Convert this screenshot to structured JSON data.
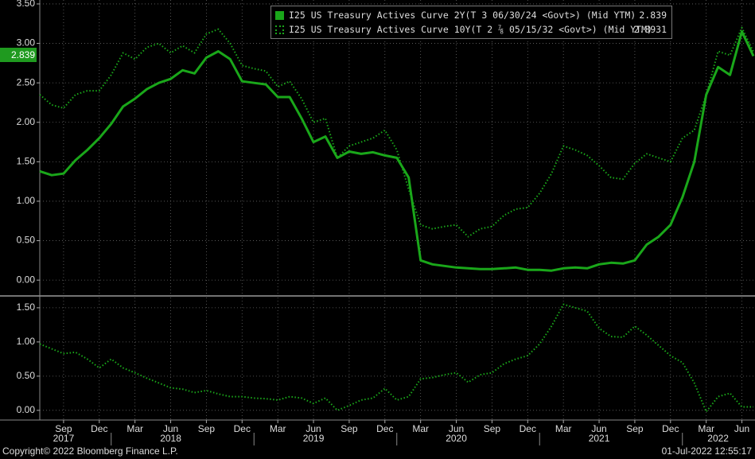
{
  "chart_data": [
    {
      "type": "line",
      "ylim": [
        -0.18,
        3.55
      ],
      "yticks": [
        "3.50",
        "3.00",
        "2.50",
        "2.00",
        "1.50",
        "1.00",
        "0.50",
        "0.00"
      ],
      "grid": true,
      "legend_position": "top-right",
      "last_value_label": "2.839",
      "series": [
        {
          "name": "I25 US Treasury Actives Curve 2Y(T 3 06/30/24 <Govt>) (Mid YTM)",
          "last": "2.839",
          "style": "solid",
          "color": "#1aa71a",
          "x": [
            "2017-07",
            "2017-08",
            "2017-09",
            "2017-10",
            "2017-11",
            "2017-12",
            "2018-01",
            "2018-02",
            "2018-03",
            "2018-04",
            "2018-05",
            "2018-06",
            "2018-07",
            "2018-08",
            "2018-09",
            "2018-10",
            "2018-11",
            "2018-12",
            "2019-01",
            "2019-02",
            "2019-03",
            "2019-04",
            "2019-05",
            "2019-06",
            "2019-07",
            "2019-08",
            "2019-09",
            "2019-10",
            "2019-11",
            "2019-12",
            "2020-01",
            "2020-02",
            "2020-03",
            "2020-04",
            "2020-05",
            "2020-06",
            "2020-07",
            "2020-08",
            "2020-09",
            "2020-10",
            "2020-11",
            "2020-12",
            "2021-01",
            "2021-02",
            "2021-03",
            "2021-04",
            "2021-05",
            "2021-06",
            "2021-07",
            "2021-08",
            "2021-09",
            "2021-10",
            "2021-11",
            "2021-12",
            "2022-01",
            "2022-02",
            "2022-03",
            "2022-04",
            "2022-05",
            "2022-06",
            "2022-06-30"
          ],
          "values": [
            1.38,
            1.33,
            1.35,
            1.52,
            1.65,
            1.8,
            1.98,
            2.2,
            2.3,
            2.42,
            2.5,
            2.55,
            2.66,
            2.62,
            2.82,
            2.9,
            2.8,
            2.52,
            2.5,
            2.48,
            2.32,
            2.32,
            2.05,
            1.75,
            1.82,
            1.55,
            1.63,
            1.6,
            1.62,
            1.58,
            1.55,
            1.3,
            0.25,
            0.2,
            0.18,
            0.16,
            0.15,
            0.14,
            0.14,
            0.15,
            0.16,
            0.13,
            0.13,
            0.12,
            0.15,
            0.16,
            0.15,
            0.2,
            0.22,
            0.21,
            0.25,
            0.45,
            0.55,
            0.7,
            1.05,
            1.5,
            2.35,
            2.7,
            2.6,
            3.15,
            2.839
          ]
        },
        {
          "name": "I25 US Treasury Actives Curve 10Y(T 2 ⅞ 05/15/32 <Govt>) (Mid YTM)",
          "last": "2.8931",
          "style": "dotted",
          "color": "#1aa71a",
          "x": [
            "2017-07",
            "2017-08",
            "2017-09",
            "2017-10",
            "2017-11",
            "2017-12",
            "2018-01",
            "2018-02",
            "2018-03",
            "2018-04",
            "2018-05",
            "2018-06",
            "2018-07",
            "2018-08",
            "2018-09",
            "2018-10",
            "2018-11",
            "2018-12",
            "2019-01",
            "2019-02",
            "2019-03",
            "2019-04",
            "2019-05",
            "2019-06",
            "2019-07",
            "2019-08",
            "2019-09",
            "2019-10",
            "2019-11",
            "2019-12",
            "2020-01",
            "2020-02",
            "2020-03",
            "2020-04",
            "2020-05",
            "2020-06",
            "2020-07",
            "2020-08",
            "2020-09",
            "2020-10",
            "2020-11",
            "2020-12",
            "2021-01",
            "2021-02",
            "2021-03",
            "2021-04",
            "2021-05",
            "2021-06",
            "2021-07",
            "2021-08",
            "2021-09",
            "2021-10",
            "2021-11",
            "2021-12",
            "2022-01",
            "2022-02",
            "2022-03",
            "2022-04",
            "2022-05",
            "2022-06",
            "2022-06-30"
          ],
          "values": [
            2.35,
            2.22,
            2.18,
            2.35,
            2.4,
            2.4,
            2.6,
            2.88,
            2.8,
            2.95,
            3.0,
            2.88,
            2.97,
            2.88,
            3.12,
            3.18,
            3.0,
            2.72,
            2.68,
            2.65,
            2.45,
            2.52,
            2.3,
            2.0,
            2.05,
            1.55,
            1.7,
            1.75,
            1.8,
            1.9,
            1.65,
            1.15,
            0.7,
            0.65,
            0.68,
            0.7,
            0.55,
            0.65,
            0.68,
            0.82,
            0.9,
            0.92,
            1.1,
            1.35,
            1.7,
            1.65,
            1.58,
            1.45,
            1.3,
            1.28,
            1.48,
            1.6,
            1.55,
            1.5,
            1.8,
            1.9,
            2.35,
            2.9,
            2.85,
            3.2,
            2.8931
          ]
        }
      ]
    },
    {
      "type": "line",
      "ylim": [
        -0.13,
        1.65
      ],
      "yticks": [
        "1.50",
        "1.00",
        "0.50",
        "0.00"
      ],
      "grid": true,
      "series": [
        {
          "style": "dotted",
          "color": "#1aa71a",
          "x": [
            "2017-07",
            "2017-08",
            "2017-09",
            "2017-10",
            "2017-11",
            "2017-12",
            "2018-01",
            "2018-02",
            "2018-03",
            "2018-04",
            "2018-05",
            "2018-06",
            "2018-07",
            "2018-08",
            "2018-09",
            "2018-10",
            "2018-11",
            "2018-12",
            "2019-01",
            "2019-02",
            "2019-03",
            "2019-04",
            "2019-05",
            "2019-06",
            "2019-07",
            "2019-08",
            "2019-09",
            "2019-10",
            "2019-11",
            "2019-12",
            "2020-01",
            "2020-02",
            "2020-03",
            "2020-04",
            "2020-05",
            "2020-06",
            "2020-07",
            "2020-08",
            "2020-09",
            "2020-10",
            "2020-11",
            "2020-12",
            "2021-01",
            "2021-02",
            "2021-03",
            "2021-04",
            "2021-05",
            "2021-06",
            "2021-07",
            "2021-08",
            "2021-09",
            "2021-10",
            "2021-11",
            "2021-12",
            "2022-01",
            "2022-02",
            "2022-03",
            "2022-04",
            "2022-05",
            "2022-06",
            "2022-06-30"
          ],
          "values": [
            0.97,
            0.9,
            0.83,
            0.85,
            0.75,
            0.62,
            0.75,
            0.62,
            0.55,
            0.47,
            0.4,
            0.33,
            0.31,
            0.26,
            0.29,
            0.24,
            0.2,
            0.2,
            0.18,
            0.17,
            0.15,
            0.2,
            0.18,
            0.1,
            0.18,
            0.0,
            0.07,
            0.15,
            0.18,
            0.32,
            0.15,
            0.2,
            0.46,
            0.48,
            0.52,
            0.55,
            0.41,
            0.52,
            0.55,
            0.68,
            0.75,
            0.8,
            0.97,
            1.23,
            1.55,
            1.5,
            1.45,
            1.2,
            1.08,
            1.07,
            1.23,
            1.1,
            0.95,
            0.8,
            0.7,
            0.4,
            -0.02,
            0.2,
            0.25,
            0.05,
            0.05
          ]
        }
      ]
    }
  ],
  "x_axis": {
    "month_labels": [
      {
        "date": "2017-09",
        "label": "Sep"
      },
      {
        "date": "2017-12",
        "label": "Dec"
      },
      {
        "date": "2018-03",
        "label": "Mar"
      },
      {
        "date": "2018-06",
        "label": "Jun"
      },
      {
        "date": "2018-09",
        "label": "Sep"
      },
      {
        "date": "2018-12",
        "label": "Dec"
      },
      {
        "date": "2019-03",
        "label": "Mar"
      },
      {
        "date": "2019-06",
        "label": "Jun"
      },
      {
        "date": "2019-09",
        "label": "Sep"
      },
      {
        "date": "2019-12",
        "label": "Dec"
      },
      {
        "date": "2020-03",
        "label": "Mar"
      },
      {
        "date": "2020-06",
        "label": "Jun"
      },
      {
        "date": "2020-09",
        "label": "Sep"
      },
      {
        "date": "2020-12",
        "label": "Dec"
      },
      {
        "date": "2021-03",
        "label": "Mar"
      },
      {
        "date": "2021-06",
        "label": "Jun"
      },
      {
        "date": "2021-09",
        "label": "Sep"
      },
      {
        "date": "2021-12",
        "label": "Dec"
      },
      {
        "date": "2022-03",
        "label": "Mar"
      },
      {
        "date": "2022-06",
        "label": "Jun"
      }
    ],
    "year_labels": [
      {
        "date": "2017-09",
        "label": "2017"
      },
      {
        "date": "2018-06",
        "label": "2018"
      },
      {
        "date": "2019-06",
        "label": "2019"
      },
      {
        "date": "2020-06",
        "label": "2020"
      },
      {
        "date": "2021-06",
        "label": "2021"
      },
      {
        "date": "2022-04",
        "label": "2022"
      }
    ]
  },
  "footer": {
    "copyright": "Copyright© 2022 Bloomberg Finance L.P.",
    "timestamp": "01-Jul-2022 12:55:17"
  }
}
